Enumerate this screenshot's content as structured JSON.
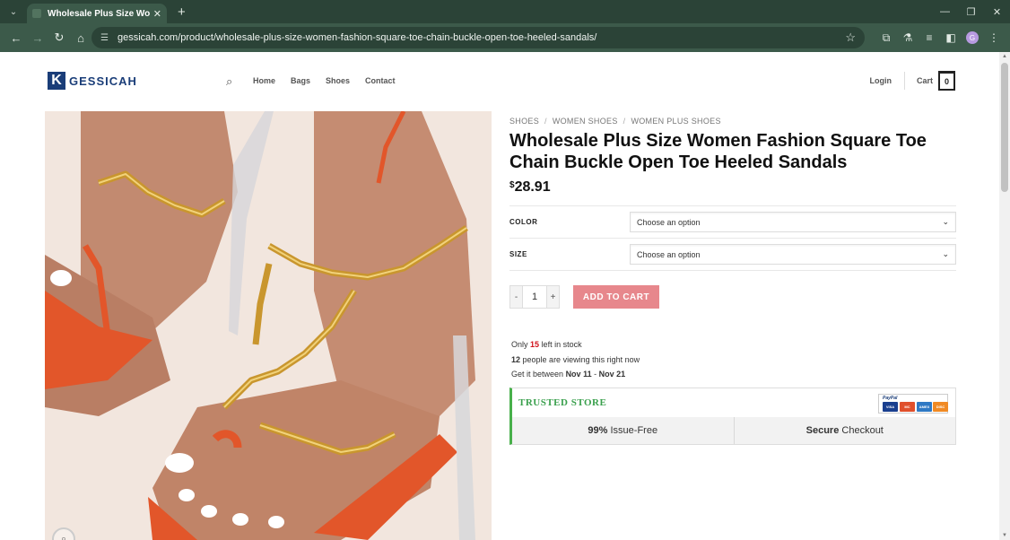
{
  "browser": {
    "tab_title": "Wholesale Plus Size Women Fa",
    "url": "gessicah.com/product/wholesale-plus-size-women-fashion-square-toe-chain-buckle-open-toe-heeled-sandals/"
  },
  "header": {
    "logo_text": "GESSICAH",
    "nav": [
      "Home",
      "Bags",
      "Shoes",
      "Contact"
    ],
    "login": "Login",
    "cart_label": "Cart",
    "cart_count": "0"
  },
  "product": {
    "breadcrumb": [
      "SHOES",
      "WOMEN SHOES",
      "WOMEN PLUS SHOES"
    ],
    "title": "Wholesale Plus Size Women Fashion Square Toe Chain Buckle Open Toe Heeled Sandals",
    "currency": "$",
    "price": "28.91",
    "variations": [
      {
        "label": "COLOR",
        "placeholder": "Choose an option"
      },
      {
        "label": "SIZE",
        "placeholder": "Choose an option"
      }
    ],
    "qty_minus": "-",
    "qty": "1",
    "qty_plus": "+",
    "add_to_cart": "ADD TO CART"
  },
  "stock": {
    "only": "Only",
    "count": "15",
    "left": "left in stock",
    "viewers": "12",
    "viewing": "people are viewing this right now",
    "delivery_prefix": "Get it between",
    "delivery_start": "Nov 11",
    "delivery_sep": " - ",
    "delivery_end": "Nov 21"
  },
  "trust": {
    "title": "TRUSTED STORE",
    "paypal_label": "PayPal",
    "cards": [
      "VISA",
      "MC",
      "AMEX",
      "DISC"
    ],
    "issue_free_value": "99%",
    "issue_free_label": "Issue-Free",
    "secure_value": "Secure",
    "secure_label": "Checkout"
  },
  "colors": {
    "browser_frame": "#2b4337",
    "accent_button": "#e7878c",
    "stock_red": "#d0111b",
    "trust_green": "#48b04b"
  }
}
